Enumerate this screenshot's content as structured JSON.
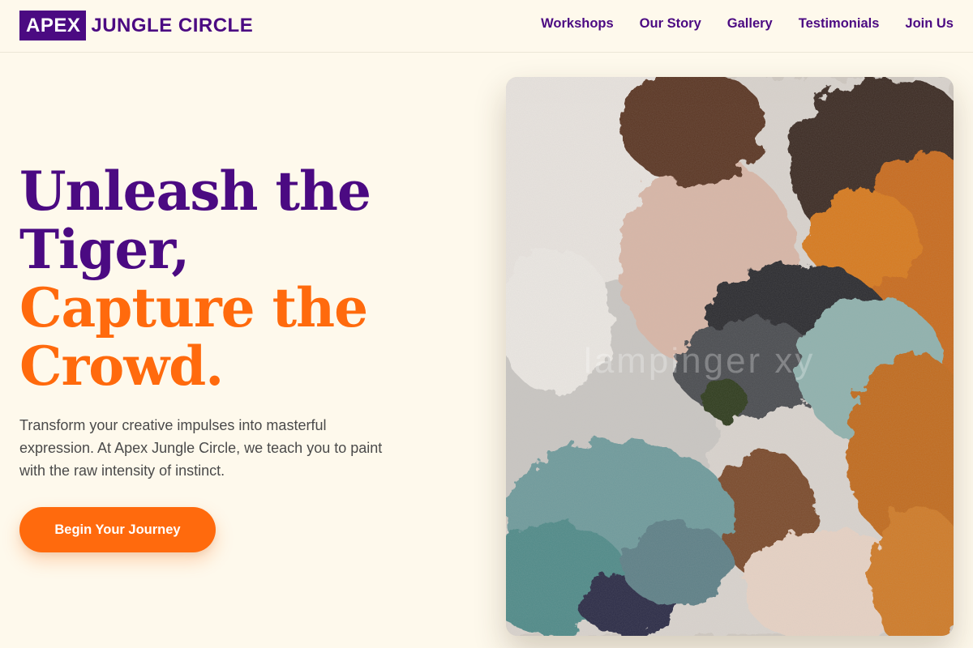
{
  "brand": {
    "box_text": "APEX",
    "text": "JUNGLE CIRCLE",
    "primary_color": "#4b0a82",
    "accent_color": "#ff6a0d"
  },
  "nav": {
    "items": [
      {
        "label": "Workshops"
      },
      {
        "label": "Our Story"
      },
      {
        "label": "Gallery"
      },
      {
        "label": "Testimonials"
      },
      {
        "label": "Join Us"
      }
    ]
  },
  "hero": {
    "title_lines": [
      {
        "text": "Unleash the",
        "color": "purple"
      },
      {
        "text": "Tiger,",
        "color": "purple"
      },
      {
        "text": "Capture the",
        "color": "orange"
      },
      {
        "text": "Crowd.",
        "color": "orange"
      }
    ],
    "description": "Transform your creative impulses into masterful expression. At Apex Jungle Circle, we teach you to paint with the raw intensity of instinct.",
    "cta_label": "Begin Your Journey"
  },
  "artwork": {
    "description_icon": "abstract-painting-image",
    "watermark_text": "lampinger xy"
  }
}
